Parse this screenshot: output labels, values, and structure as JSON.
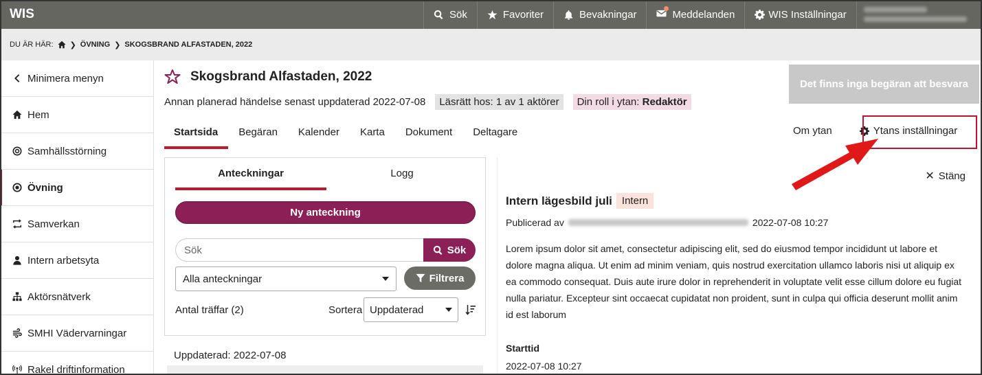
{
  "app": {
    "title": "WIS"
  },
  "topnav": [
    {
      "label": "Sök",
      "icon": "search-icon"
    },
    {
      "label": "Favoriter",
      "icon": "star-icon"
    },
    {
      "label": "Bevakningar",
      "icon": "bell-icon"
    },
    {
      "label": "Meddelanden",
      "icon": "envelope-icon"
    },
    {
      "label": "WIS Inställningar",
      "icon": "gear-icon"
    }
  ],
  "breadcrumb": {
    "prefix": "DU ÄR HÄR:",
    "items": [
      "ÖVNING",
      "SKOGSBRAND ALFASTADEN, 2022"
    ]
  },
  "sidebar": {
    "items": [
      {
        "label": "Minimera menyn",
        "icon": "chevron-left-icon"
      },
      {
        "label": "Hem",
        "icon": "home-icon"
      },
      {
        "label": "Samhällsstörning",
        "icon": "target-icon"
      },
      {
        "label": "Övning",
        "icon": "target-icon",
        "active": true
      },
      {
        "label": "Samverkan",
        "icon": "exchange-icon"
      },
      {
        "label": "Intern arbetsyta",
        "icon": "user-icon"
      },
      {
        "label": "Aktörsnätverk",
        "icon": "network-icon"
      },
      {
        "label": "SMHI Vädervarningar",
        "icon": "wind-icon"
      },
      {
        "label": "Rakel driftinformation",
        "icon": "antenna-icon"
      }
    ]
  },
  "page": {
    "title": "Skogsbrand Alfastaden, 2022",
    "subtitle": "Annan planerad händelse senast uppdaterad 2022-07-08",
    "read_badge": "Läsrätt hos: 1 av 1 aktörer",
    "role_prefix": "Din roll i ytan:",
    "role_value": "Redaktör",
    "request_status": "Det finns inga begäran att besvara"
  },
  "tabs": [
    "Startsida",
    "Begäran",
    "Kalender",
    "Karta",
    "Dokument",
    "Deltagare"
  ],
  "right_tabs": {
    "about": "Om ytan",
    "settings": "Ytans inställningar"
  },
  "notes": {
    "tabs": [
      "Anteckningar",
      "Logg"
    ],
    "new_button": "Ny anteckning",
    "search_placeholder": "Sök",
    "search_button": "Sök",
    "filter_select": "Alla anteckningar",
    "filter_button": "Filtrera",
    "count": "Antal träffar (2)",
    "sort_label": "Sortera",
    "sort_value": "Uppdaterad",
    "updated": "Uppdaterad: 2022-07-08"
  },
  "post": {
    "close": "Stäng",
    "title": "Intern lägesbild juli",
    "badge": "Intern",
    "published_prefix": "Publicerad av",
    "published_date": "2022-07-08 10:27",
    "body": "Lorem ipsum dolor sit amet, consectetur adipiscing elit, sed do eiusmod tempor incididunt ut labore et dolore magna aliqua. Ut enim ad minim veniam, quis nostrud exercitation ullamco laboris nisi ut aliquip ex ea commodo consequat. Duis aute irure dolor in reprehenderit in voluptate velit esse cillum dolore eu fugiat nulla pariatur. Excepteur sint occaecat cupidatat non proident, sunt in culpa qui officia deserunt mollit anim id est laborum",
    "start_label": "Starttid",
    "start_value": "2022-07-08 10:27"
  },
  "colors": {
    "topbar": "#656660",
    "primary": "#8c1f55",
    "accent_red": "#c0182c",
    "annotation_red": "#e01818"
  }
}
